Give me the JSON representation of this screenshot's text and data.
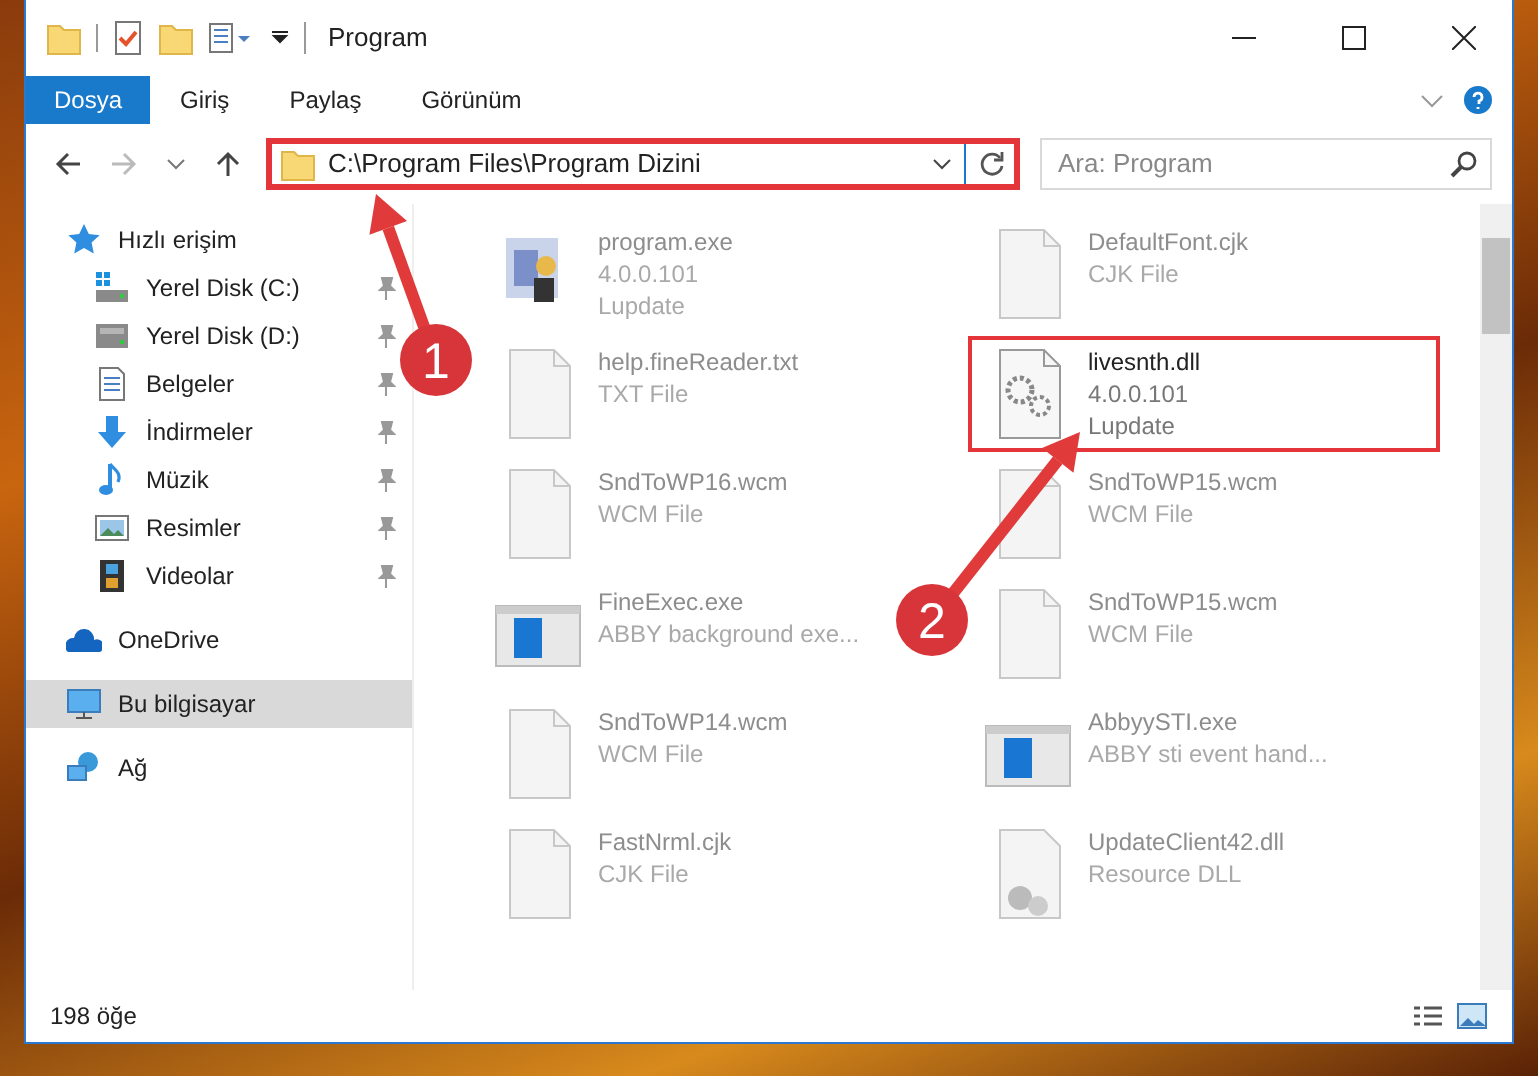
{
  "window": {
    "title": "Program"
  },
  "ribbon_tabs": [
    {
      "label": "Dosya",
      "kind": "file"
    },
    {
      "label": "Giriş",
      "kind": "tab"
    },
    {
      "label": "Paylaş",
      "kind": "tab"
    },
    {
      "label": "Görünüm",
      "kind": "tab"
    }
  ],
  "address_bar": {
    "path": "C:\\Program Files\\Program Dizini",
    "highlighted": true
  },
  "search": {
    "placeholder": "Ara: Program"
  },
  "sidebar": {
    "items": [
      {
        "label": "Hızlı erişim",
        "kind": "quick",
        "pinned": false,
        "selected": false
      },
      {
        "label": "Yerel Disk (C:)",
        "kind": "system-drive",
        "pinned": true,
        "selected": false
      },
      {
        "label": "Yerel Disk (D:)",
        "kind": "drive",
        "pinned": true,
        "selected": false
      },
      {
        "label": "Belgeler",
        "kind": "documents",
        "pinned": true,
        "selected": false
      },
      {
        "label": "İndirmeler",
        "kind": "downloads",
        "pinned": true,
        "selected": false
      },
      {
        "label": "Müzik",
        "kind": "music",
        "pinned": true,
        "selected": false
      },
      {
        "label": "Resimler",
        "kind": "pictures",
        "pinned": true,
        "selected": false
      },
      {
        "label": "Videolar",
        "kind": "videos",
        "pinned": true,
        "selected": false
      },
      {
        "label": "OneDrive",
        "kind": "cloud",
        "pinned": false,
        "selected": false
      },
      {
        "label": "Bu bilgisayar",
        "kind": "computer",
        "pinned": false,
        "selected": true
      },
      {
        "label": "Ağ",
        "kind": "network",
        "pinned": false,
        "selected": false
      }
    ]
  },
  "files": [
    {
      "name": "program.exe",
      "details": [
        "4.0.0.101",
        "Lupdate"
      ],
      "kind": "program",
      "blurred": true,
      "highlighted": false
    },
    {
      "name": "DefaultFont.cjk",
      "details": [
        "CJK File"
      ],
      "kind": "blank",
      "blurred": true,
      "highlighted": false
    },
    {
      "name": "help.fineReader.txt",
      "details": [
        "TXT File"
      ],
      "kind": "blank",
      "blurred": true,
      "highlighted": false
    },
    {
      "name": "livesnth.dll",
      "details": [
        "4.0.0.101",
        "Lupdate"
      ],
      "kind": "settings",
      "blurred": false,
      "highlighted": true
    },
    {
      "name": "SndToWP16.wcm",
      "details": [
        "WCM File"
      ],
      "kind": "blank",
      "blurred": true,
      "highlighted": false
    },
    {
      "name": "SndToWP15.wcm",
      "details": [
        "WCM File"
      ],
      "kind": "blank",
      "blurred": true,
      "highlighted": false
    },
    {
      "name": "FineExec.exe",
      "details": [
        "ABBY background exe..."
      ],
      "kind": "app",
      "blurred": true,
      "highlighted": false
    },
    {
      "name": "SndToWP15.wcm",
      "details": [
        "WCM File"
      ],
      "kind": "blank",
      "blurred": true,
      "highlighted": false
    },
    {
      "name": "SndToWP14.wcm",
      "details": [
        "WCM File"
      ],
      "kind": "blank",
      "blurred": true,
      "highlighted": false
    },
    {
      "name": "AbbyySTI.exe",
      "details": [
        "ABBY sti event hand..."
      ],
      "kind": "app",
      "blurred": true,
      "highlighted": false
    },
    {
      "name": "FastNrml.cjk",
      "details": [
        "CJK File"
      ],
      "kind": "blank",
      "blurred": true,
      "highlighted": false
    },
    {
      "name": "UpdateClient42.dll",
      "details": [
        "Resource DLL"
      ],
      "kind": "dll",
      "blurred": true,
      "highlighted": false
    }
  ],
  "status_bar": {
    "item_count": "198 öğe"
  },
  "callouts": [
    {
      "number": "1"
    },
    {
      "number": "2"
    }
  ]
}
